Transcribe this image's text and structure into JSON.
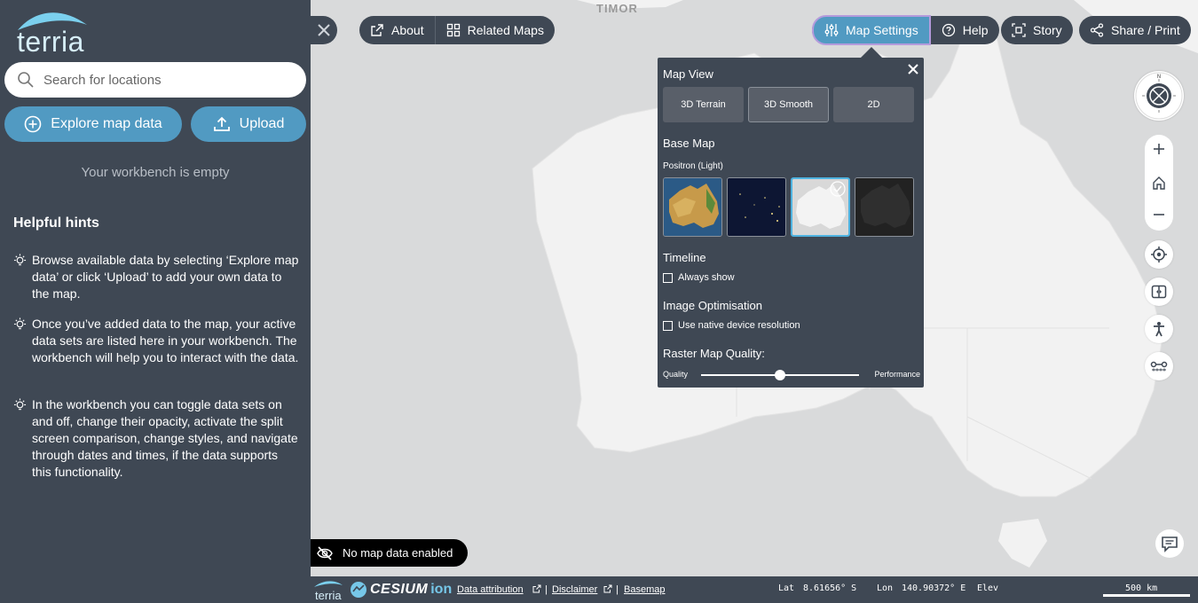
{
  "app": {
    "name": "terria"
  },
  "map": {
    "region_label": "TIMOR"
  },
  "sidebar": {
    "search_placeholder": "Search for locations",
    "explore_label": "Explore map data",
    "upload_label": "Upload",
    "workbench_empty": "Your workbench is empty",
    "hints_title": "Helpful hints",
    "hints": [
      "Browse available data by selecting ‘Explore map data’ or click ‘Upload’ to add your own data to the map.",
      "Once you’ve added data to the map, your active data sets are listed here in your workbench. The workbench will help you to interact with the data.",
      "In the workbench you can toggle data sets on and off, change their opacity, activate the split screen comparison, change styles, and navigate through dates and times, if the data supports this functionality."
    ]
  },
  "nav": {
    "about": "About",
    "related_maps": "Related Maps",
    "map_settings": "Map Settings",
    "help": "Help",
    "story": "Story",
    "share_print": "Share / Print"
  },
  "settings": {
    "map_view_title": "Map View",
    "view_modes": [
      "3D Terrain",
      "3D Smooth",
      "2D"
    ],
    "active_view": "3D Smooth",
    "base_map_title": "Base Map",
    "base_map_selected": "Positron (Light)",
    "timeline_title": "Timeline",
    "timeline_always_show": "Always show",
    "image_opt_title": "Image Optimisation",
    "native_resolution": "Use native device resolution",
    "raster_quality_title": "Raster Map Quality:",
    "quality_label": "Quality",
    "performance_label": "Performance",
    "raster_quality_value": 0.5
  },
  "status": {
    "no_data": "No map data enabled"
  },
  "footer": {
    "cesium": "CESIUM",
    "ion": "ion",
    "data_attribution": "Data attribution",
    "pipe": "|",
    "disclaimer": "Disclaimer",
    "basemap": "Basemap",
    "lat_label": "Lat",
    "lat_value": "8.61656° S",
    "lon_label": "Lon",
    "lon_value": "140.90372° E",
    "elev_label": "Elev",
    "scale": "500 km"
  },
  "colors": {
    "sidebar_bg": "#3f4854",
    "accent": "#519ac2",
    "map_bg": "#d9dadb",
    "land": "#f2f2f2"
  },
  "compass": {
    "north": "N"
  }
}
